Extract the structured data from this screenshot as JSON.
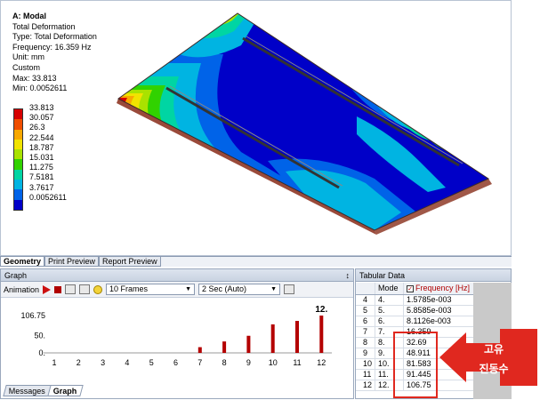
{
  "info": {
    "title": "A: Modal",
    "lines": [
      "Total Deformation",
      "Type: Total Deformation",
      "Frequency: 16.359 Hz",
      "Unit: mm",
      "Custom",
      "Max: 33.813",
      "Min: 0.0052611"
    ]
  },
  "legend": {
    "labels": [
      "33.813",
      "30.057",
      "26.3",
      "22.544",
      "18.787",
      "15.031",
      "11.275",
      "7.5181",
      "3.7617",
      "0.0052611"
    ],
    "colors": [
      "#d60000",
      "#f04e00",
      "#f8a800",
      "#f1e300",
      "#a9e200",
      "#31d200",
      "#00d5a3",
      "#00b4e2",
      "#0063e8",
      "#0000c8"
    ]
  },
  "view_tabs": [
    "Geometry",
    "Print Preview",
    "Report Preview"
  ],
  "graph": {
    "title": "Graph",
    "pin": "p",
    "animation_label": "Animation",
    "frames": "10 Frames",
    "duration": "2 Sec (Auto)",
    "bottom_tabs": [
      "Messages",
      "Graph"
    ]
  },
  "chart_data": {
    "type": "bar",
    "categories": [
      "1",
      "2",
      "3",
      "4",
      "5",
      "6",
      "7",
      "8",
      "9",
      "10",
      "11",
      "12"
    ],
    "values": [
      1.27e-05,
      0.0015785,
      0.0058585,
      0.0081126,
      0,
      0,
      16.359,
      32.69,
      48.911,
      81.583,
      91.445,
      106.75
    ],
    "yticks": [
      "106.75",
      "50.",
      "0."
    ],
    "ylim": [
      0,
      106.75
    ],
    "highlight_label": "12.",
    "bar_color": "#b40000"
  },
  "tabular": {
    "title": "Tabular Data",
    "headers": [
      "Mode",
      "Frequency [Hz]"
    ],
    "rows": [
      {
        "n": "4",
        "mode": "4.",
        "freq": "1.5785e-003"
      },
      {
        "n": "5",
        "mode": "5.",
        "freq": "5.8585e-003"
      },
      {
        "n": "6",
        "mode": "6.",
        "freq": "8.1126e-003"
      },
      {
        "n": "7",
        "mode": "7.",
        "freq": "16.359"
      },
      {
        "n": "8",
        "mode": "8.",
        "freq": "32.69"
      },
      {
        "n": "9",
        "mode": "9.",
        "freq": "48.911"
      },
      {
        "n": "10",
        "mode": "10.",
        "freq": "81.583"
      },
      {
        "n": "11",
        "mode": "11.",
        "freq": "91.445"
      },
      {
        "n": "12",
        "mode": "12.",
        "freq": "106.75"
      }
    ]
  },
  "annotation": {
    "line1": "고유",
    "line2": "진동수",
    "color": "#e0281f"
  }
}
